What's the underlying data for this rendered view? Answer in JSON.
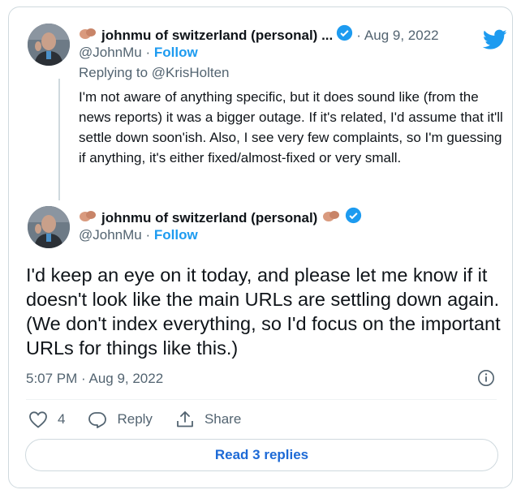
{
  "colors": {
    "accent": "#1d9bf0",
    "text_primary": "#0f1419",
    "text_secondary": "#536471",
    "border": "#cfd9de"
  },
  "parent_tweet": {
    "display_name": "johnmu of switzerland (personal) ...",
    "handle": "@JohnMu",
    "separator": "·",
    "follow_label": "Follow",
    "date": "Aug 9, 2022",
    "replying_prefix": "Replying to",
    "replying_to": "@KrisHolten",
    "text": "I'm not aware of anything specific, but it does sound like (from the news reports) it was a bigger outage. If it's related, I'd assume that it'll settle down soon'ish. Also, I see very few complaints, so I'm guessing if anything, it's either fixed/almost-fixed or very small."
  },
  "main_tweet": {
    "display_name": "johnmu of switzerland (personal)",
    "handle": "@JohnMu",
    "separator": "·",
    "follow_label": "Follow",
    "text": "I'd keep an eye on it today, and please let me know if it doesn't look like the main URLs are settling down again. (We don't index everything, so I'd focus on the important URLs for things like this.)",
    "timestamp": "5:07 PM · Aug 9, 2022"
  },
  "actions": {
    "like_count": "4",
    "reply_label": "Reply",
    "share_label": "Share"
  },
  "read_replies_label": "Read 3 replies",
  "icons": [
    "emoji-icon",
    "verified-icon",
    "twitter-logo-icon",
    "info-icon",
    "heart-icon",
    "reply-icon",
    "share-icon"
  ]
}
